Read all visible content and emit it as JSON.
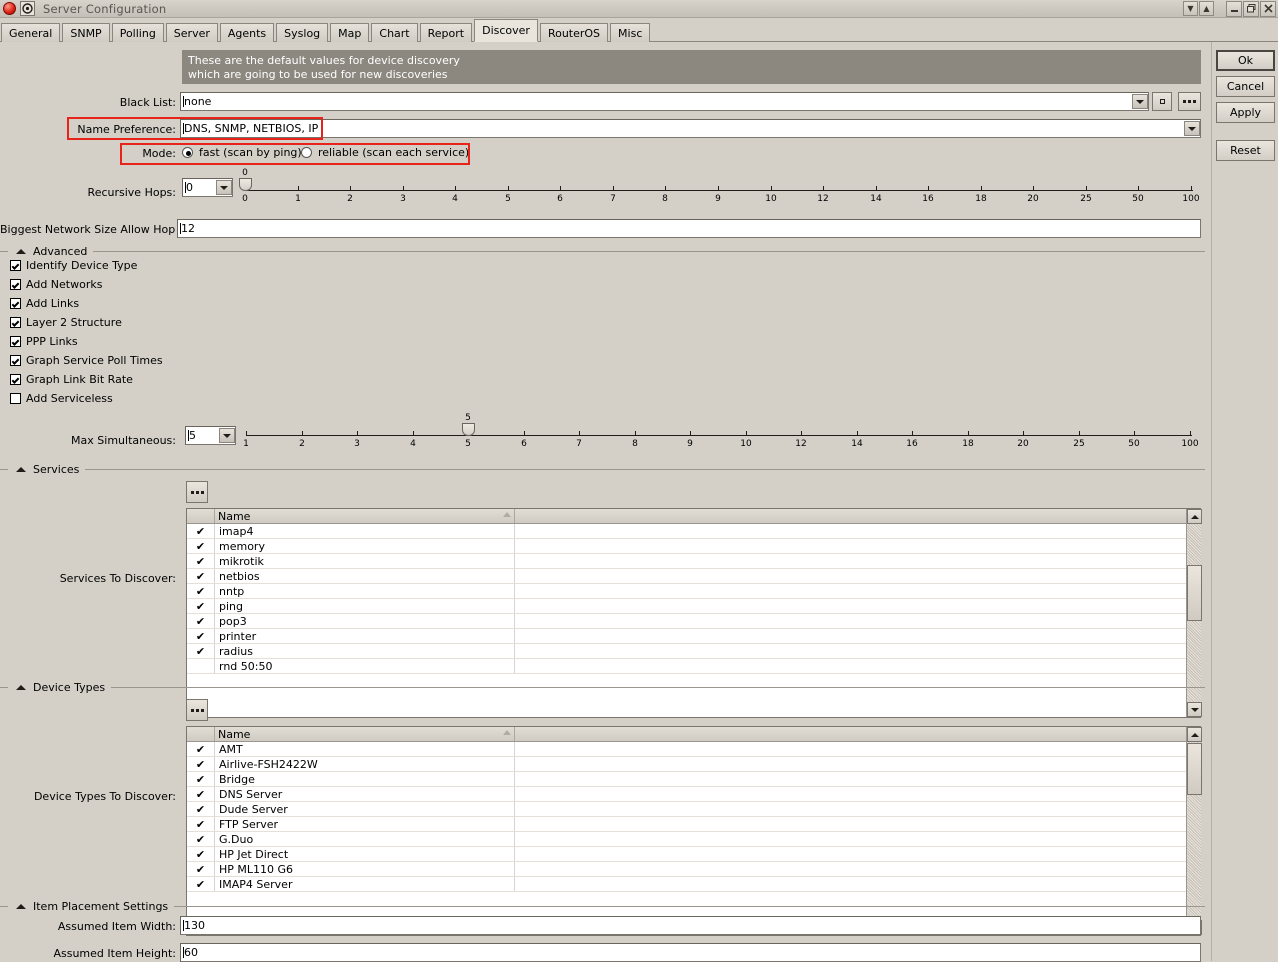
{
  "window": {
    "title": "Server Configuration",
    "icons": {
      "app": "dude-icon",
      "ball": "red-ball-icon",
      "collapse_down": "chevron-down-icon",
      "collapse_up": "chevron-up-icon",
      "minimize": "minimize-icon",
      "restore": "restore-icon",
      "close": "close-icon"
    }
  },
  "tabs": [
    {
      "label": "General",
      "active": false
    },
    {
      "label": "SNMP",
      "active": false
    },
    {
      "label": "Polling",
      "active": false
    },
    {
      "label": "Server",
      "active": false
    },
    {
      "label": "Agents",
      "active": false
    },
    {
      "label": "Syslog",
      "active": false
    },
    {
      "label": "Map",
      "active": false
    },
    {
      "label": "Chart",
      "active": false
    },
    {
      "label": "Report",
      "active": false
    },
    {
      "label": "Discover",
      "active": true
    },
    {
      "label": "RouterOS",
      "active": false
    },
    {
      "label": "Misc",
      "active": false
    }
  ],
  "action_buttons": [
    {
      "label": "Ok",
      "default": true
    },
    {
      "label": "Cancel",
      "default": false
    },
    {
      "label": "Apply",
      "default": false
    },
    {
      "label": "Reset",
      "default": false
    }
  ],
  "banner": {
    "line1": "These are the default values for device discovery",
    "line2": "which are going to be used for new discoveries"
  },
  "form": {
    "black_list": {
      "label": "Black List:",
      "value": "none"
    },
    "name_preference": {
      "label": "Name Preference:",
      "value": "DNS, SNMP, NETBIOS, IP",
      "highlighted": true
    },
    "mode": {
      "label": "Mode:",
      "highlighted": true,
      "options": [
        {
          "label": "fast (scan by ping)",
          "selected": true
        },
        {
          "label": "reliable (scan each service)",
          "selected": false
        }
      ]
    },
    "recursive_hops": {
      "label": "Recursive Hops:",
      "value": "0"
    },
    "biggest_network": {
      "label": "Biggest Network Size Allow Hop To:",
      "value": "12"
    },
    "max_simultaneous": {
      "label": "Max Simultaneous:",
      "value": "5"
    }
  },
  "hops_slider": {
    "thumb_label": "0",
    "thumb_index": 0,
    "ticks": [
      "0",
      "1",
      "2",
      "3",
      "4",
      "5",
      "6",
      "7",
      "8",
      "9",
      "10",
      "12",
      "14",
      "16",
      "18",
      "20",
      "25",
      "50",
      "100"
    ]
  },
  "simultaneous_slider": {
    "thumb_label": "5",
    "thumb_index": 4,
    "ticks": [
      "1",
      "2",
      "3",
      "4",
      "5",
      "6",
      "7",
      "8",
      "9",
      "10",
      "12",
      "14",
      "16",
      "18",
      "20",
      "25",
      "50",
      "100"
    ]
  },
  "advanced": {
    "title": "Advanced",
    "items": [
      {
        "label": "Identify Device Type",
        "checked": true
      },
      {
        "label": "Add Networks",
        "checked": true
      },
      {
        "label": "Add Links",
        "checked": true
      },
      {
        "label": "Layer 2 Structure",
        "checked": true
      },
      {
        "label": "PPP Links",
        "checked": true
      },
      {
        "label": "Graph Service Poll Times",
        "checked": true
      },
      {
        "label": "Graph Link Bit Rate",
        "checked": true
      },
      {
        "label": "Add Serviceless",
        "checked": false
      }
    ]
  },
  "services": {
    "title": "Services",
    "list_label": "Services To Discover:",
    "column_header": "Name",
    "rows": [
      {
        "name": "imap4",
        "checked": true
      },
      {
        "name": "memory",
        "checked": true
      },
      {
        "name": "mikrotik",
        "checked": true
      },
      {
        "name": "netbios",
        "checked": true
      },
      {
        "name": "nntp",
        "checked": true
      },
      {
        "name": "ping",
        "checked": true
      },
      {
        "name": "pop3",
        "checked": true
      },
      {
        "name": "printer",
        "checked": true
      },
      {
        "name": "radius",
        "checked": true
      },
      {
        "name": "rnd 50:50",
        "checked": false
      }
    ]
  },
  "device_types": {
    "title": "Device Types",
    "list_label": "Device Types To Discover:",
    "column_header": "Name",
    "rows": [
      {
        "name": "AMT",
        "checked": true
      },
      {
        "name": "Airlive-FSH2422W",
        "checked": true
      },
      {
        "name": "Bridge",
        "checked": true
      },
      {
        "name": "DNS Server",
        "checked": true
      },
      {
        "name": "Dude Server",
        "checked": true
      },
      {
        "name": "FTP Server",
        "checked": true
      },
      {
        "name": "G.Duo",
        "checked": true
      },
      {
        "name": "HP Jet Direct",
        "checked": true
      },
      {
        "name": "HP ML110 G6",
        "checked": true
      },
      {
        "name": "IMAP4 Server",
        "checked": true
      }
    ]
  },
  "item_placement": {
    "title": "Item Placement Settings",
    "width": {
      "label": "Assumed Item Width:",
      "value": "130"
    },
    "height": {
      "label": "Assumed Item Height:",
      "value": "60"
    }
  },
  "colors": {
    "window_bg": "#d4d0c8",
    "banner_bg": "#8c8880",
    "highlight": "#e8241a",
    "field_bg": "#ffffff"
  },
  "checkmark": "✔"
}
